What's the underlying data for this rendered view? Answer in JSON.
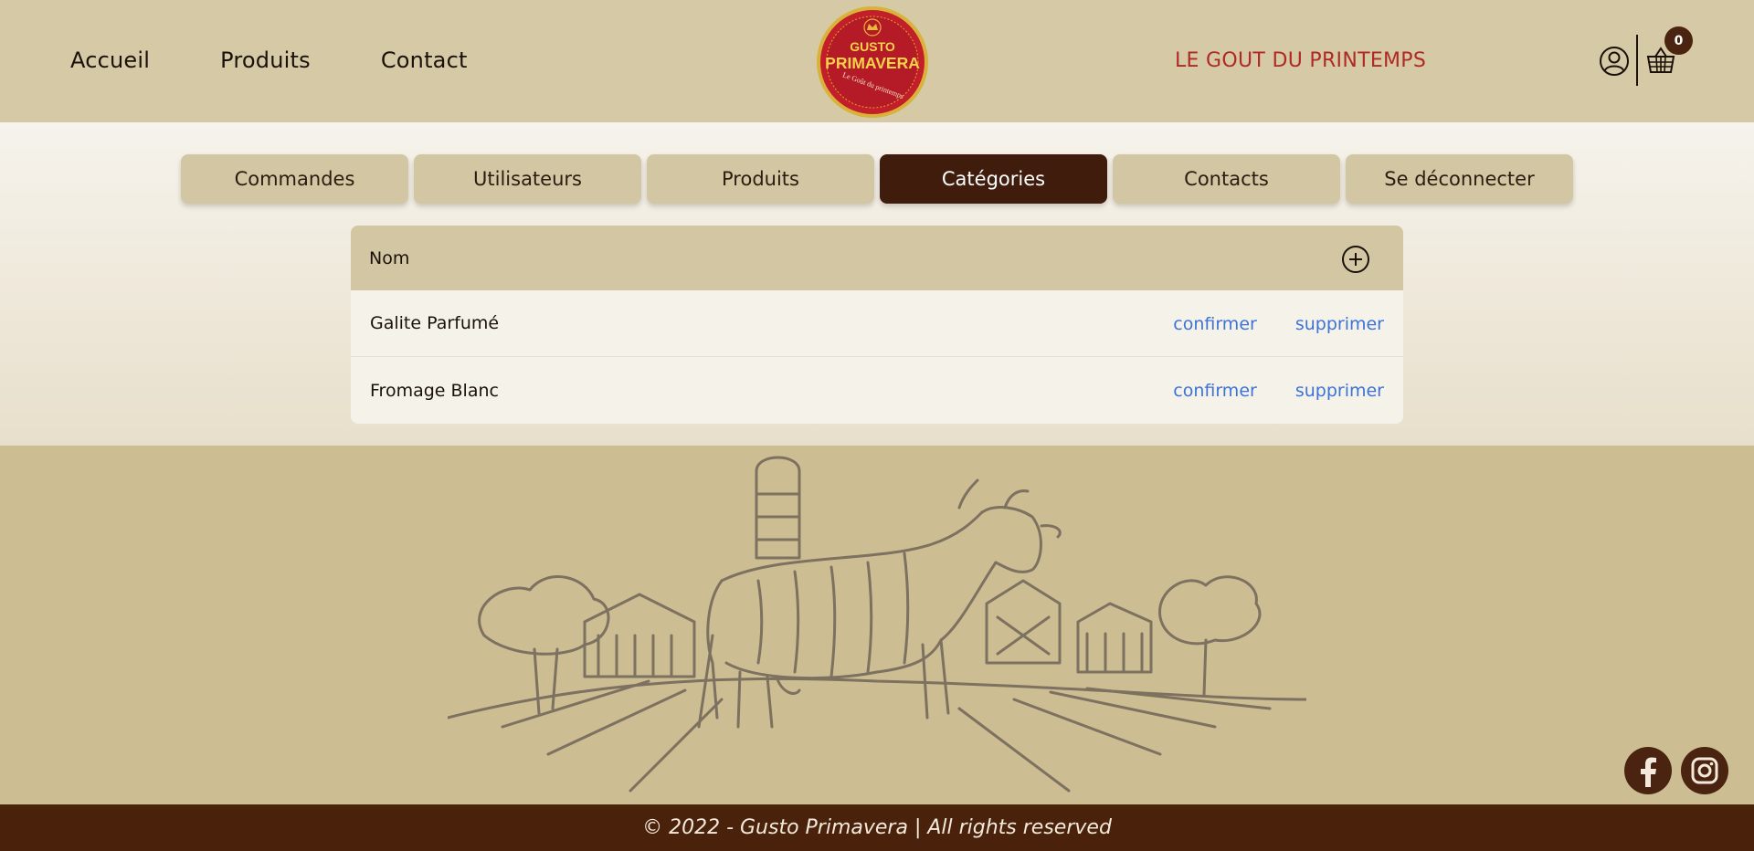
{
  "header": {
    "nav": [
      "Accueil",
      "Produits",
      "Contact"
    ],
    "logo": {
      "top_text": "GUSTO",
      "main_text": "PRIMAVERA",
      "sub_text": "Le Goût du printemps"
    },
    "tagline": "LE GOUT DU PRINTEMPS",
    "cart_count": "0",
    "icons": {
      "user": "user-circle-icon",
      "cart": "basket-icon"
    }
  },
  "tabs": [
    {
      "label": "Commandes",
      "active": false
    },
    {
      "label": "Utilisateurs",
      "active": false
    },
    {
      "label": "Produits",
      "active": false
    },
    {
      "label": "Catégories",
      "active": true
    },
    {
      "label": "Contacts",
      "active": false
    },
    {
      "label": "Se déconnecter",
      "active": false
    }
  ],
  "table": {
    "header": "Nom",
    "add_icon": "plus-circle-icon",
    "rows": [
      {
        "name": "Galite Parfumé",
        "confirm": "confirmer",
        "delete": "supprimer"
      },
      {
        "name": "Fromage Blanc",
        "confirm": "confirmer",
        "delete": "supprimer"
      }
    ]
  },
  "footer": {
    "copyright": "© 2022 - Gusto Primavera | All rights reserved",
    "social": [
      "facebook-icon",
      "instagram-icon"
    ]
  },
  "colors": {
    "header_bg": "#d6c9a5",
    "active_tab": "#401c0d",
    "tagline": "#b02a25",
    "link": "#3d73d6",
    "footer_bar": "#4a210b"
  }
}
